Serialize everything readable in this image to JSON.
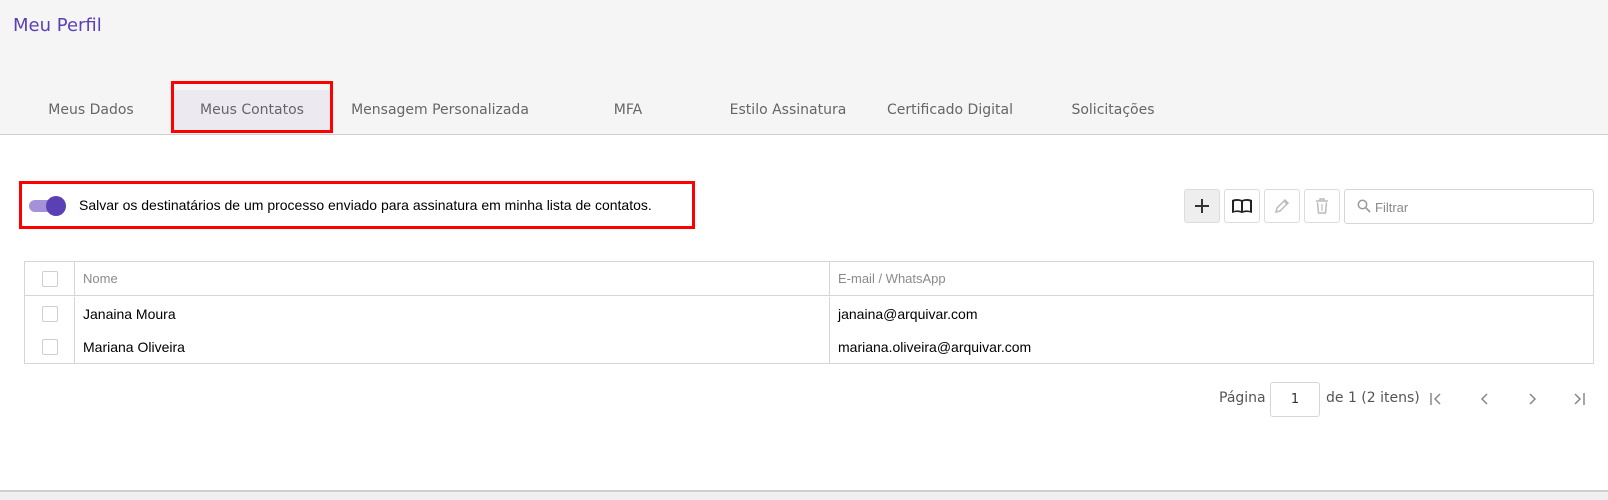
{
  "header": {
    "title": "Meu Perfil"
  },
  "tabs": [
    {
      "label": "Meus Dados"
    },
    {
      "label": "Meus Contatos"
    },
    {
      "label": "Mensagem Personalizada"
    },
    {
      "label": "MFA"
    },
    {
      "label": "Estilo Assinatura"
    },
    {
      "label": "Certificado Digital"
    },
    {
      "label": "Solicitações"
    }
  ],
  "active_tab": "Meus Contatos",
  "settings": {
    "save_recipients_label": "Salvar os destinatários de um processo enviado para assinatura em minha lista de contatos.",
    "save_recipients_enabled": true
  },
  "toolbar": {
    "icons": [
      "plus-icon",
      "address-book-icon",
      "pencil-icon",
      "trash-icon"
    ],
    "filter_placeholder": "Filtrar"
  },
  "table": {
    "columns": [
      "Nome",
      "E-mail / WhatsApp"
    ],
    "rows": [
      {
        "name": "Janaina Moura",
        "contact": "janaina@arquivar.com"
      },
      {
        "name": "Mariana Oliveira",
        "contact": "mariana.oliveira@arquivar.com"
      }
    ]
  },
  "pagination": {
    "page_label": "Página",
    "current_page": "1",
    "summary": "de 1 (2 itens)"
  },
  "colors": {
    "accent": "#5b3fb5",
    "toggle_track": "#a591d8",
    "highlight": "#ff0000"
  }
}
